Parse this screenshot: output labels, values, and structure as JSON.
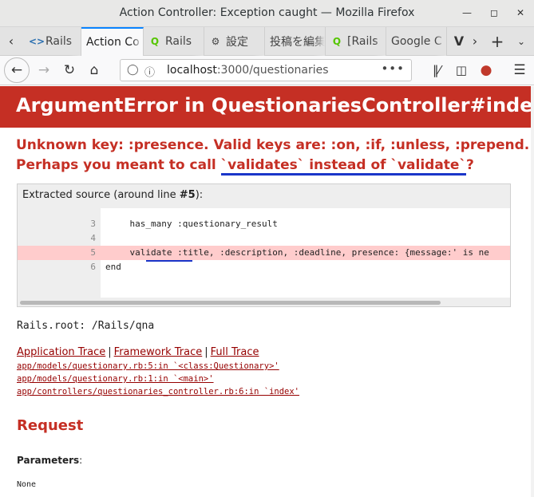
{
  "window": {
    "title": "Action Controller: Exception caught — Mozilla Firefox"
  },
  "tabs": [
    {
      "label": "Rails",
      "icon": "code-icon",
      "glyph": "<>"
    },
    {
      "label": "Action Co",
      "icon": "none",
      "glyph": ""
    },
    {
      "label": "Rails",
      "icon": "qiita-icon",
      "glyph": "Q"
    },
    {
      "label": "設定",
      "icon": "gear-icon",
      "glyph": "⚙"
    },
    {
      "label": "投稿を編集",
      "icon": "none",
      "glyph": ""
    },
    {
      "label": "[Rails",
      "icon": "qiita-icon",
      "glyph": "Q"
    },
    {
      "label": "Google C",
      "icon": "none",
      "glyph": ""
    }
  ],
  "navbar": {
    "url_host": "localhost",
    "url_path": ":3000/questionaries"
  },
  "page": {
    "heading": "ArgumentError in QuestionariesController#index",
    "message_line1": "Unknown key: :presence. Valid keys are: :on, :if, :unless, :prepend.",
    "message_line2_prefix": "Perhaps you meant to call ",
    "message_line2_highlight": "`validates` instead of `validate`",
    "message_line2_suffix": "?",
    "source_header": "Extracted source (around line ",
    "source_line_bold": "#5",
    "source_header_suffix": "):",
    "source_lines": [
      {
        "num": "3",
        "code": "    has_many :questionary_result"
      },
      {
        "num": "4",
        "code": ""
      },
      {
        "num": "5",
        "code": "    validate :title, :description, :deadline, presence: {message:' is ne"
      },
      {
        "num": "6",
        "code": "end"
      }
    ],
    "rails_root": "Rails.root: /Rails/qna",
    "trace_links": [
      "Application Trace",
      "Framework Trace",
      "Full Trace"
    ],
    "trace_separator": "|",
    "trace_lines": [
      "app/models/questionary.rb:5:in `<class:Questionary>'",
      "app/models/questionary.rb:1:in `<main>'",
      "app/controllers/questionaries_controller.rb:6:in `index'"
    ],
    "request_heading": "Request",
    "parameters_label": "Parameters",
    "parameters_colon": ":",
    "parameters_value": "None"
  },
  "colors": {
    "error_red": "#c52f24",
    "link_red": "#960000",
    "highlight_line": "#ffcccc",
    "annotation_blue": "#1a35c9"
  }
}
